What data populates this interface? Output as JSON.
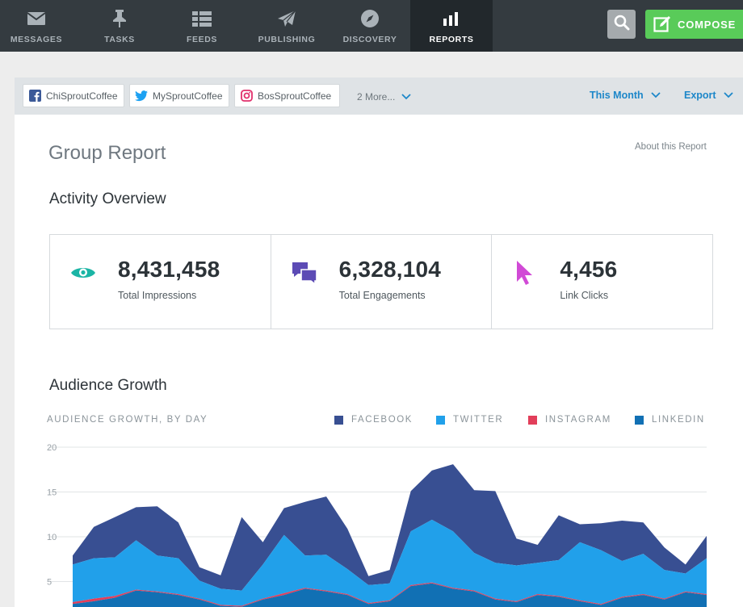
{
  "nav": {
    "items": [
      {
        "label": "MESSAGES",
        "icon": "envelope-icon"
      },
      {
        "label": "TASKS",
        "icon": "pin-icon"
      },
      {
        "label": "FEEDS",
        "icon": "list-icon"
      },
      {
        "label": "PUBLISHING",
        "icon": "paper-plane-icon"
      },
      {
        "label": "DISCOVERY",
        "icon": "compass-icon"
      },
      {
        "label": "REPORTS",
        "icon": "bar-chart-icon",
        "active": true
      }
    ],
    "compose_label": "COMPOSE"
  },
  "filters": {
    "profiles": [
      {
        "name": "ChiSproutCoffee",
        "network": "facebook",
        "color": "#3b5998"
      },
      {
        "name": "MySproutCoffee",
        "network": "twitter",
        "color": "#1da1f2"
      },
      {
        "name": "BosSproutCoffee",
        "network": "instagram",
        "color": "#e1306c"
      }
    ],
    "more_label": "2 More...",
    "date_range": "This Month",
    "export_label": "Export"
  },
  "report": {
    "title": "Group Report",
    "about_link": "About this Report",
    "activity_heading": "Activity Overview",
    "stats": [
      {
        "value": "8,431,458",
        "label": "Total Impressions",
        "icon": "eye-icon",
        "color": "#1bb5a5"
      },
      {
        "value": "6,328,104",
        "label": "Total Engagements",
        "icon": "chat-bubbles-icon",
        "color": "#5c4bb5"
      },
      {
        "value": "4,456",
        "label": "Link Clicks",
        "icon": "cursor-icon",
        "color": "#d14ad6"
      }
    ],
    "growth_heading": "Audience Growth",
    "chart_subtitle": "AUDIENCE GROWTH, BY DAY"
  },
  "chart_data": {
    "type": "area",
    "subtitle": "AUDIENCE GROWTH, BY DAY",
    "ylim": [
      0,
      20
    ],
    "yticks": [
      5,
      10,
      15,
      20
    ],
    "grid": true,
    "legend_position": "top-right",
    "x": [
      1,
      2,
      3,
      4,
      5,
      6,
      7,
      8,
      9,
      10,
      11,
      12,
      13,
      14,
      15,
      16,
      17,
      18,
      19,
      20,
      21,
      22,
      23,
      24,
      25,
      26,
      27,
      28,
      29,
      30,
      31
    ],
    "series": [
      {
        "name": "LINKEDIN",
        "color": "#1170b4",
        "values": [
          2.5,
          2.8,
          3.2,
          4.0,
          3.8,
          3.5,
          3.0,
          2.3,
          2.2,
          3.0,
          3.5,
          4.2,
          3.9,
          3.5,
          2.5,
          2.8,
          4.5,
          4.8,
          4.2,
          3.9,
          3.0,
          2.7,
          3.5,
          3.3,
          2.8,
          2.4,
          3.2,
          3.5,
          3.0,
          3.8,
          3.5
        ]
      },
      {
        "name": "INSTAGRAM",
        "color": "#e23e5a",
        "values": [
          0.2,
          0.3,
          0.2,
          0.1,
          0.1,
          0.1,
          0.1,
          0.1,
          0.1,
          0.1,
          0.2,
          0.1,
          0.1,
          0.1,
          0.1,
          0.1,
          0.1,
          0.1,
          0.1,
          0.1,
          0.1,
          0.1,
          0.1,
          0.1,
          0.1,
          0.1,
          0.1,
          0.1,
          0.1,
          0.1,
          0.1
        ]
      },
      {
        "name": "TWITTER",
        "color": "#21a0ea",
        "values": [
          4.2,
          4.5,
          4.3,
          5.5,
          4.0,
          4.0,
          2.0,
          1.8,
          1.7,
          3.8,
          6.5,
          3.6,
          4.0,
          2.8,
          2.0,
          1.9,
          6.0,
          7.0,
          6.3,
          4.2,
          4.0,
          4.0,
          3.5,
          4.0,
          6.5,
          6.0,
          4.0,
          4.5,
          3.2,
          2.0,
          4.0
        ]
      },
      {
        "name": "FACEBOOK",
        "color": "#384f92",
        "values": [
          1.0,
          3.5,
          4.5,
          3.7,
          5.5,
          4.0,
          1.5,
          1.5,
          8.2,
          2.5,
          3.0,
          6.0,
          6.5,
          4.5,
          1.0,
          1.5,
          4.5,
          5.5,
          7.5,
          7.0,
          8.0,
          3.0,
          2.0,
          5.0,
          2.0,
          3.0,
          4.5,
          3.5,
          2.5,
          1.0,
          2.5
        ]
      }
    ]
  }
}
